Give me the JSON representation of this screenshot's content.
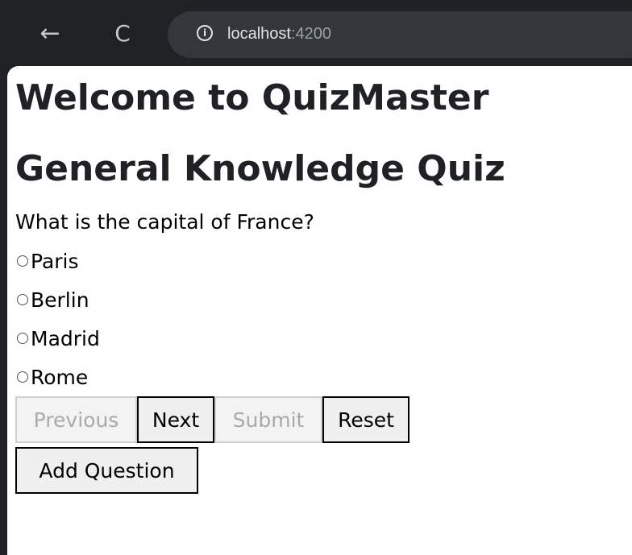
{
  "browser": {
    "back_glyph": "←",
    "reload_glyph": "C",
    "url_host": "localhost",
    "url_port": ":4200"
  },
  "page": {
    "heading": "Welcome to QuizMaster",
    "quiz_title": "General Knowledge Quiz",
    "question": "What is the capital of France?",
    "options": [
      "Paris",
      "Berlin",
      "Madrid",
      "Rome"
    ]
  },
  "buttons": {
    "previous": "Previous",
    "next": "Next",
    "submit": "Submit",
    "reset": "Reset",
    "add_question": "Add Question"
  }
}
